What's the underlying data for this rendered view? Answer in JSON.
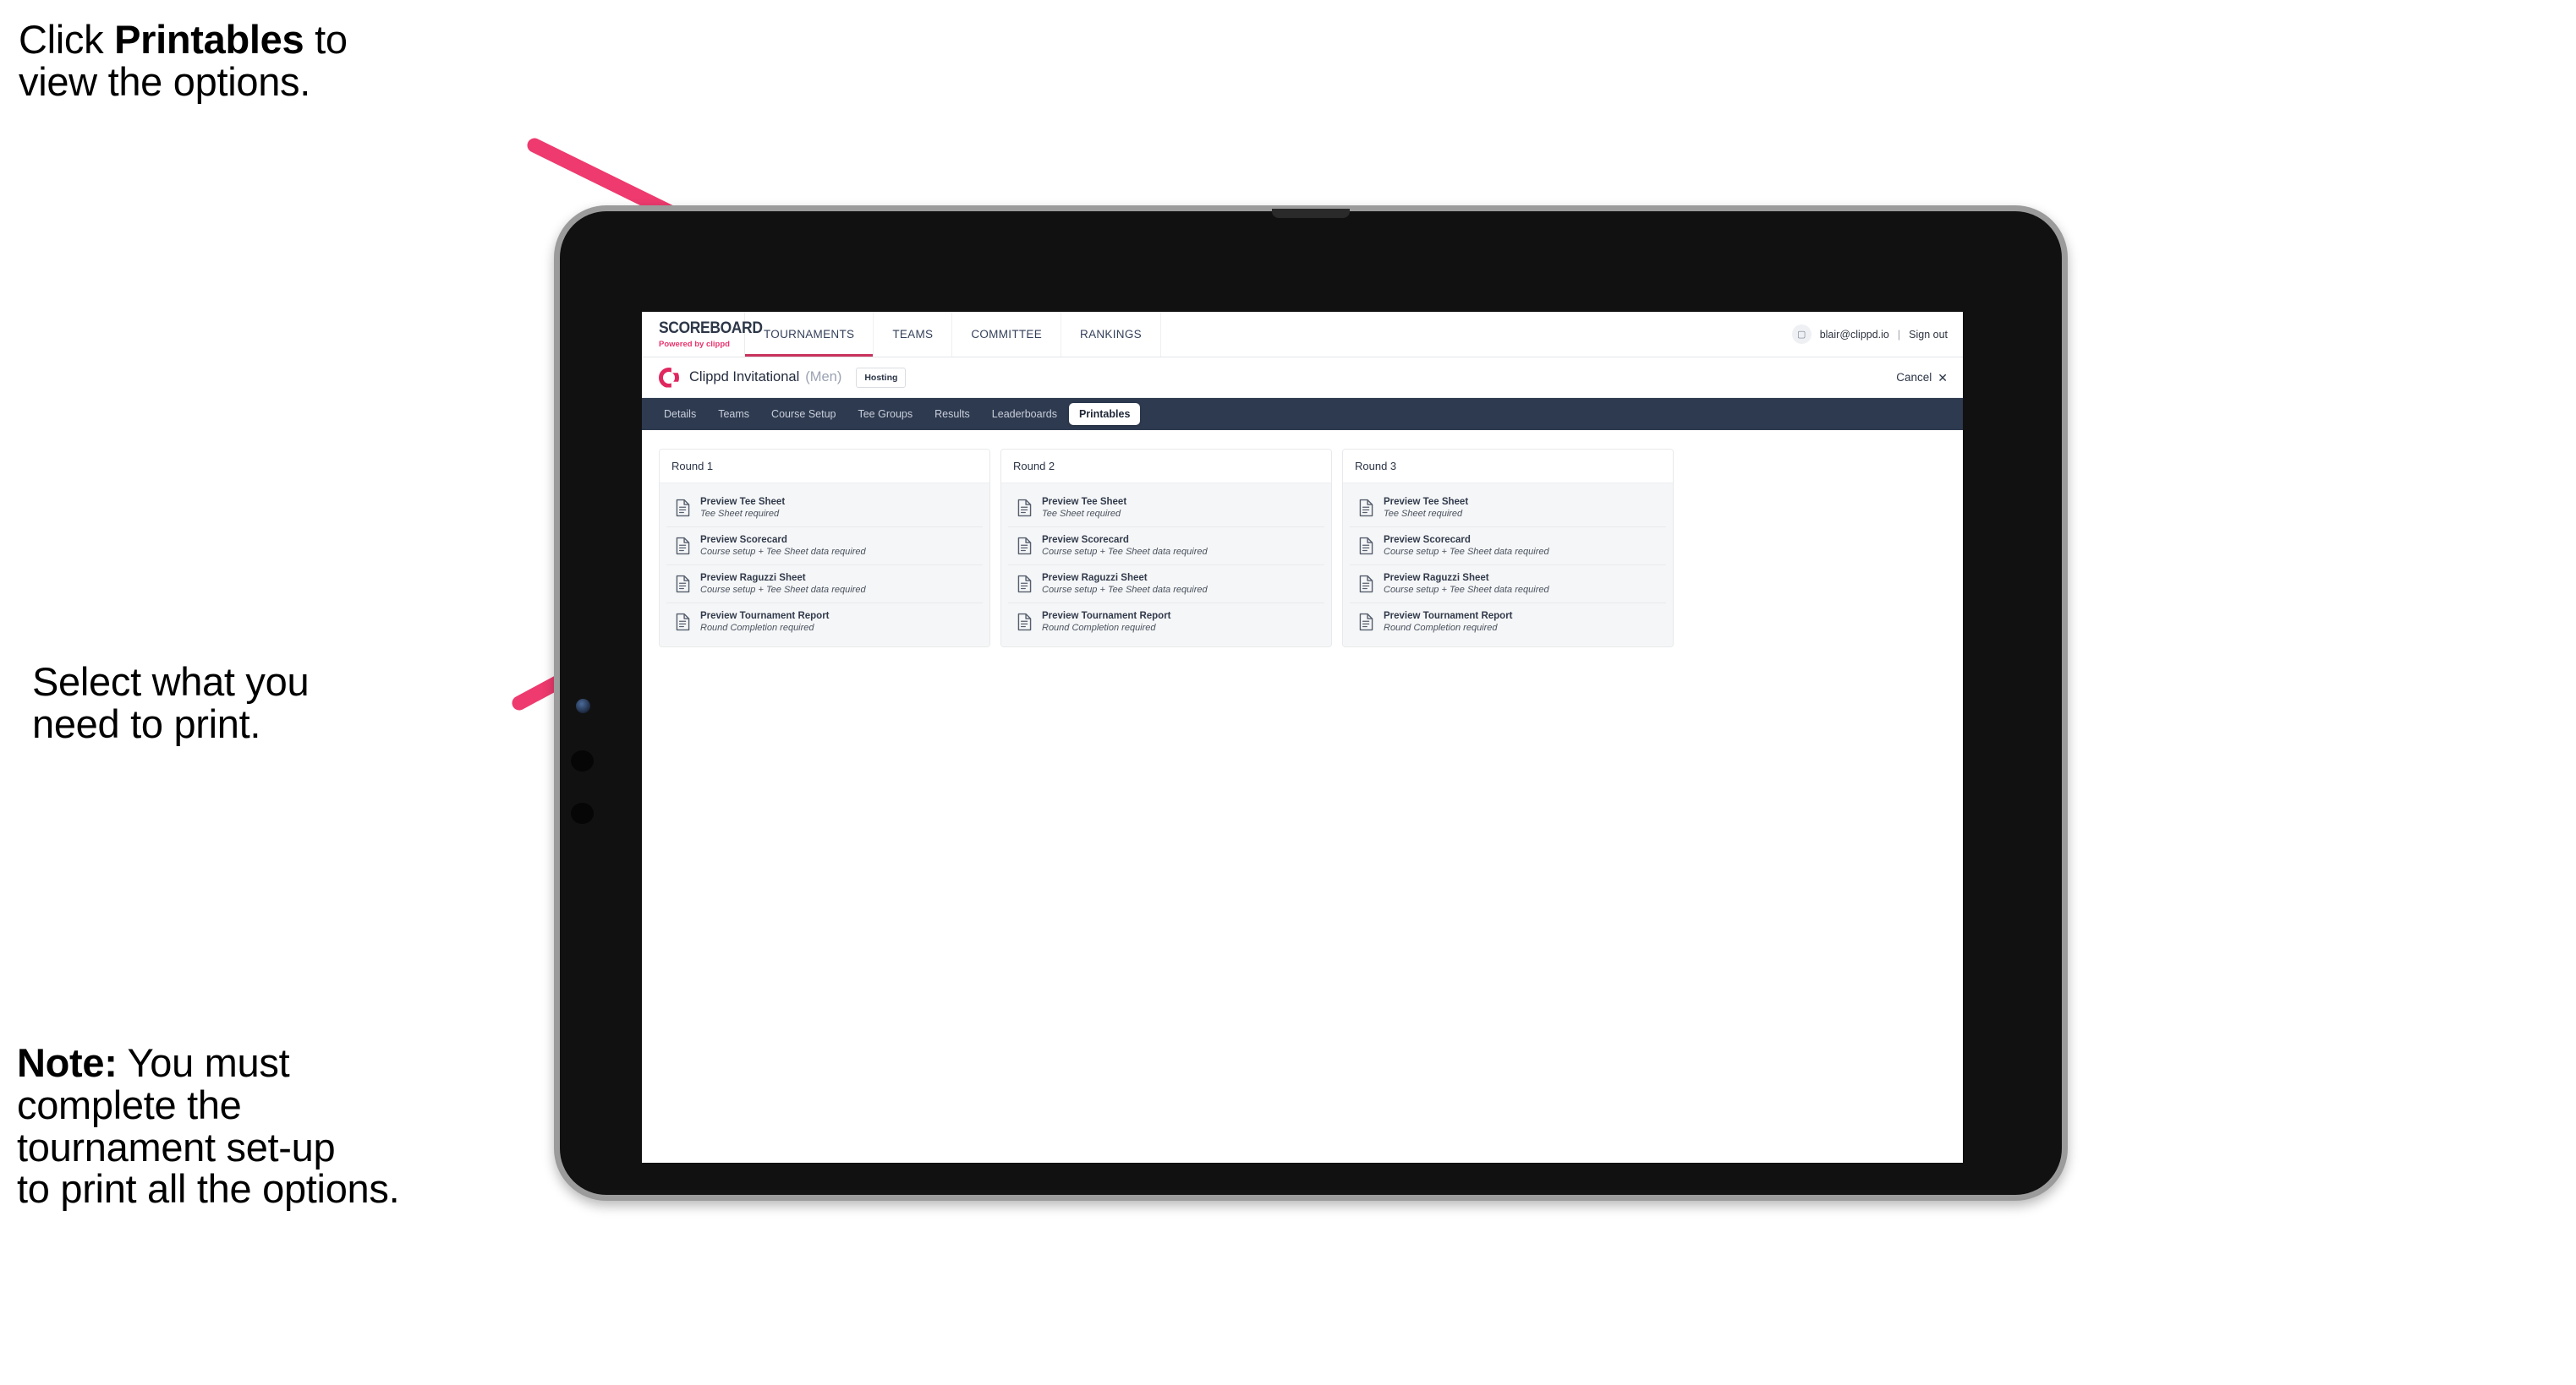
{
  "annotations": {
    "step1": "Click Printables to\nview the options.",
    "step1_plain_before": "Click ",
    "step1_bold": "Printables",
    "step1_plain_after": " to\nview the options.",
    "step2": "Select what you\n need to print.",
    "step3_bold": "Note:",
    "step3_rest": " You must\ncomplete the\ntournament set-up\nto print all the options."
  },
  "topnav": {
    "brand_title": "SCOREBOARD",
    "brand_sub_prefix": "Powered by ",
    "brand_sub_accent": "clippd",
    "menu": [
      {
        "label": "TOURNAMENTS",
        "active": true
      },
      {
        "label": "TEAMS",
        "active": false
      },
      {
        "label": "COMMITTEE",
        "active": false
      },
      {
        "label": "RANKINGS",
        "active": false
      }
    ],
    "avatar_icon": "user-avatar-icon",
    "user_email": "blair@clippd.io",
    "separator": "|",
    "sign_out": "Sign out"
  },
  "subheader": {
    "logo_icon": "clippd-c-logo-icon",
    "tournament_name": "Clippd Invitational",
    "gender": "(Men)",
    "badge": "Hosting",
    "cancel_label": "Cancel",
    "cancel_icon": "close-x-icon"
  },
  "tabs": [
    {
      "label": "Details",
      "active": false
    },
    {
      "label": "Teams",
      "active": false
    },
    {
      "label": "Course Setup",
      "active": false
    },
    {
      "label": "Tee Groups",
      "active": false
    },
    {
      "label": "Results",
      "active": false
    },
    {
      "label": "Leaderboards",
      "active": false
    },
    {
      "label": "Printables",
      "active": true
    }
  ],
  "rounds": [
    {
      "title": "Round 1",
      "items": [
        {
          "title": "Preview Tee Sheet",
          "sub": "Tee Sheet required",
          "icon": "document-icon"
        },
        {
          "title": "Preview Scorecard",
          "sub": "Course setup + Tee Sheet data required",
          "icon": "document-icon"
        },
        {
          "title": "Preview Raguzzi Sheet",
          "sub": "Course setup + Tee Sheet data required",
          "icon": "document-icon"
        },
        {
          "title": "Preview Tournament Report",
          "sub": "Round Completion required",
          "icon": "document-icon"
        }
      ]
    },
    {
      "title": "Round 2",
      "items": [
        {
          "title": "Preview Tee Sheet",
          "sub": "Tee Sheet required",
          "icon": "document-icon"
        },
        {
          "title": "Preview Scorecard",
          "sub": "Course setup + Tee Sheet data required",
          "icon": "document-icon"
        },
        {
          "title": "Preview Raguzzi Sheet",
          "sub": "Course setup + Tee Sheet data required",
          "icon": "document-icon"
        },
        {
          "title": "Preview Tournament Report",
          "sub": "Round Completion required",
          "icon": "document-icon"
        }
      ]
    },
    {
      "title": "Round 3",
      "items": [
        {
          "title": "Preview Tee Sheet",
          "sub": "Tee Sheet required",
          "icon": "document-icon"
        },
        {
          "title": "Preview Scorecard",
          "sub": "Course setup + Tee Sheet data required",
          "icon": "document-icon"
        },
        {
          "title": "Preview Raguzzi Sheet",
          "sub": "Course setup + Tee Sheet data required",
          "icon": "document-icon"
        },
        {
          "title": "Preview Tournament Report",
          "sub": "Round Completion required",
          "icon": "document-icon"
        }
      ]
    }
  ],
  "colors": {
    "arrow_pink": "#EE3A6E",
    "tabbar_navy": "#2E3A50",
    "brand_accent": "#E8336D",
    "active_underline": "#C8325C"
  }
}
